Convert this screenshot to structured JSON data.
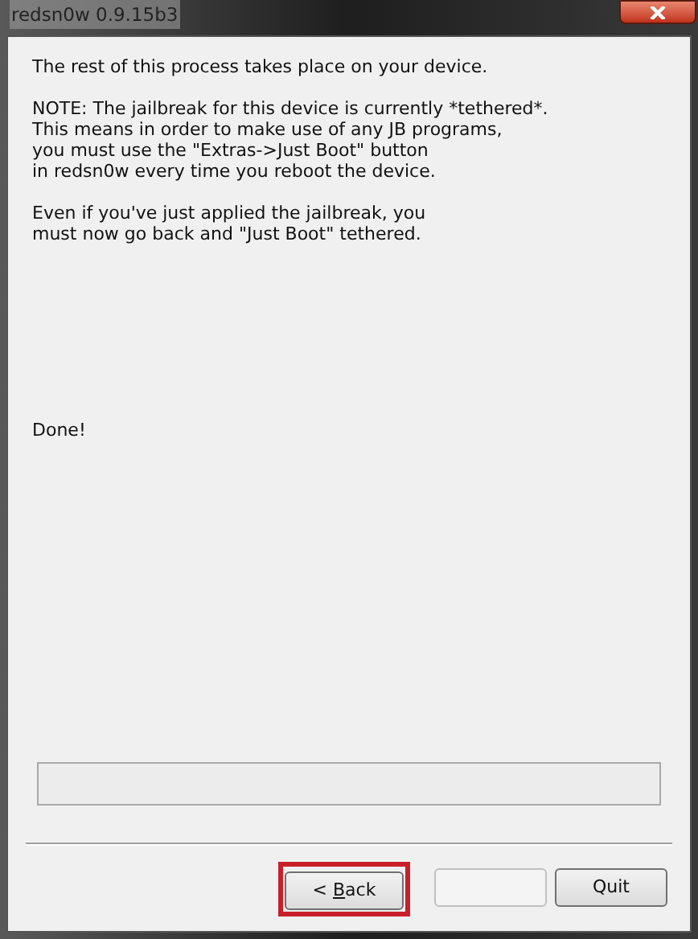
{
  "window": {
    "title": "redsn0w 0.9.15b3"
  },
  "message": {
    "paragraphs": [
      {
        "lines": [
          "The rest of this process takes place on your device."
        ]
      },
      {
        "lines": [
          "NOTE:  The jailbreak for this device is currently *tethered*.",
          "This means in order to make use of any JB programs,",
          "you must use the \"Extras->Just Boot\" button",
          "in redsn0w every time you reboot the device."
        ]
      },
      {
        "lines": [
          "Even if you've just applied the jailbreak, you",
          "must now go back and \"Just Boot\" tethered."
        ]
      }
    ]
  },
  "status": "Done!",
  "progress": {
    "level": 0
  },
  "buttons": [
    {
      "label_parts": [
        {
          "text": "< ",
          "underlined": false
        },
        {
          "text": "B",
          "underlined": true
        },
        {
          "text": "ack",
          "underlined": false
        }
      ],
      "disabled": false,
      "highlighted": true
    },
    {
      "disabled": true,
      "highlighted": false
    },
    {
      "label_parts": [
        {
          "text": "Quit",
          "underlined": false
        }
      ],
      "disabled": false,
      "highlighted": false
    }
  ]
}
